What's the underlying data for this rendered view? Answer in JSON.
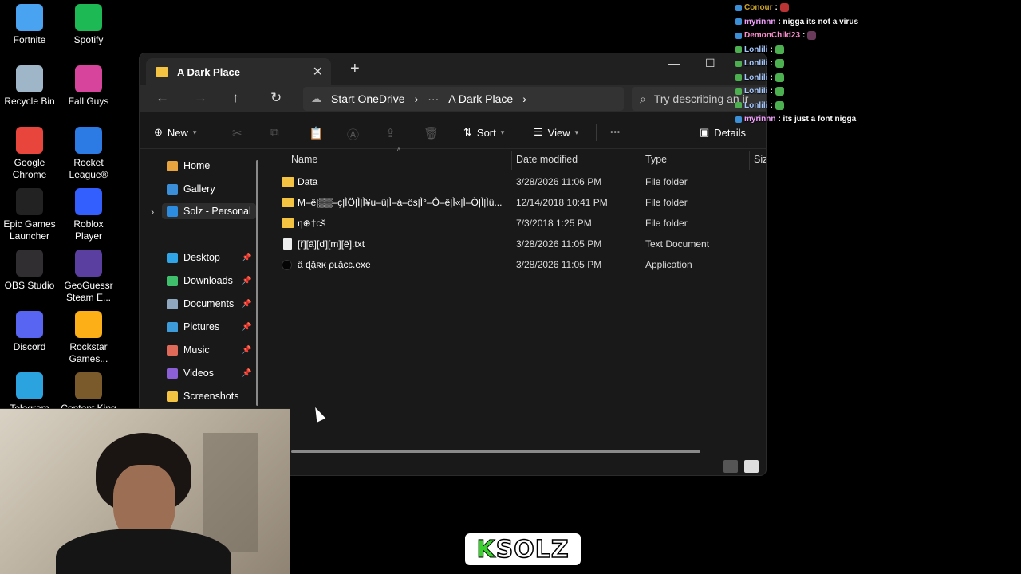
{
  "desktop": {
    "icons": [
      {
        "label": "Fortnite",
        "icon": "fortnite-icon",
        "color": "#4aa3f0"
      },
      {
        "label": "Spotify",
        "icon": "spotify-icon",
        "color": "#1db954"
      },
      {
        "label": "Recycle Bin",
        "icon": "recycle-bin-icon",
        "color": "#9fb6c8"
      },
      {
        "label": "Fall Guys",
        "icon": "fall-guys-icon",
        "color": "#d6459b"
      },
      {
        "label": "Google Chrome",
        "icon": "chrome-icon",
        "color": "#e8453c"
      },
      {
        "label": "Rocket League®",
        "icon": "rocket-league-icon",
        "color": "#2c7be5"
      },
      {
        "label": "Epic Games Launcher",
        "icon": "epic-games-icon",
        "color": "#222222"
      },
      {
        "label": "Roblox Player",
        "icon": "roblox-icon",
        "color": "#335fff"
      },
      {
        "label": "OBS Studio",
        "icon": "obs-icon",
        "color": "#302e31"
      },
      {
        "label": "GeoGuessr Steam E...",
        "icon": "geoguessr-icon",
        "color": "#5a3fa0"
      },
      {
        "label": "Discord",
        "icon": "discord-icon",
        "color": "#5865f2"
      },
      {
        "label": "Rockstar Games...",
        "icon": "rockstar-icon",
        "color": "#fcaf17"
      },
      {
        "label": "Telegram",
        "icon": "telegram-icon",
        "color": "#2aa3df"
      },
      {
        "label": "Content King",
        "icon": "content-king-icon",
        "color": "#7a5a2a"
      }
    ]
  },
  "explorer": {
    "tab_title": "A Dark Place",
    "tab_close": "✕",
    "new_tab": "+",
    "minimize": "—",
    "maximize": "☐",
    "nav": {
      "back": "←",
      "forward": "→",
      "up": "↑",
      "refresh": "↻"
    },
    "address": {
      "crumbs": [
        "Start OneDrive",
        "···",
        "A Dark Place"
      ],
      "separator": "›"
    },
    "search_placeholder": "Try describing an ir",
    "toolbar": {
      "new_label": "New",
      "sort_label": "Sort",
      "view_label": "View",
      "more": "···",
      "details_label": "Details"
    },
    "sidebar": {
      "top": [
        {
          "label": "Home",
          "icon": "home-icon",
          "color": "#e7a33e"
        },
        {
          "label": "Gallery",
          "icon": "gallery-icon",
          "color": "#3b8fd9"
        },
        {
          "label": "Solz - Personal",
          "icon": "onedrive-icon",
          "color": "#2c8de0"
        }
      ],
      "expand": "›",
      "pinned": [
        {
          "label": "Desktop",
          "icon": "desktop-icon",
          "color": "#2fa4e7"
        },
        {
          "label": "Downloads",
          "icon": "downloads-icon",
          "color": "#3fbf6c"
        },
        {
          "label": "Documents",
          "icon": "documents-icon",
          "color": "#8fa8c0"
        },
        {
          "label": "Pictures",
          "icon": "pictures-icon",
          "color": "#3c9bd8"
        },
        {
          "label": "Music",
          "icon": "music-icon",
          "color": "#e06a5a"
        },
        {
          "label": "Videos",
          "icon": "videos-icon",
          "color": "#8b5fd6"
        },
        {
          "label": "Screenshots",
          "icon": "folder-icon",
          "color": "#f5c342"
        }
      ],
      "pin_glyph": "📌"
    },
    "columns": {
      "name": "Name",
      "date": "Date modified",
      "type": "Type",
      "size": "Size"
    },
    "files": [
      {
        "name": "Data",
        "date": "3/28/2026 11:06 PM",
        "type": "File folder",
        "kind": "folder"
      },
      {
        "name": "M–ê|▒▒–ç|ÌÖ|Ì|Ì¥u–ü|Ì–à–ös|Ì°–Ô–ê|Ì«|Ì–Ò|Ì|Ìü...",
        "date": "12/14/2018 10:41 PM",
        "type": "File folder",
        "kind": "folder"
      },
      {
        "name": "η⊕†cš",
        "date": "7/3/2018 1:25 PM",
        "type": "File folder",
        "kind": "folder"
      },
      {
        "name": "[ř][ā][ď][m][ē].txt",
        "date": "3/28/2026 11:05 PM",
        "type": "Text Document",
        "kind": "txt"
      },
      {
        "name": "ä ɖặʀĸ ρʟặcɛ.exe",
        "date": "3/28/2026 11:05 PM",
        "type": "Application",
        "kind": "exe"
      }
    ]
  },
  "chat": {
    "messages": [
      {
        "user": "Conour",
        "text": ":",
        "user_color": "#c9a227"
      },
      {
        "user": "myrinnn",
        "text": ": nigga its not a virus",
        "user_color": "#f2a0ff"
      },
      {
        "user": "DemonChild23",
        "text": ":",
        "user_color": "#ff8fd0"
      },
      {
        "user": "Lonlili",
        "text": ":",
        "user_color": "#a4c8ff"
      },
      {
        "user": "Lonlili",
        "text": ":",
        "user_color": "#a4c8ff"
      },
      {
        "user": "Lonlili",
        "text": ":",
        "user_color": "#a4c8ff"
      },
      {
        "user": "Lonlili",
        "text": ":",
        "user_color": "#a4c8ff"
      },
      {
        "user": "Lonlili",
        "text": ":",
        "user_color": "#a4c8ff"
      },
      {
        "user": "myrinnn",
        "text": ": its just a font nigga",
        "user_color": "#f2a0ff"
      }
    ]
  },
  "brand": {
    "k": "K",
    "rest": "SOLZ"
  }
}
